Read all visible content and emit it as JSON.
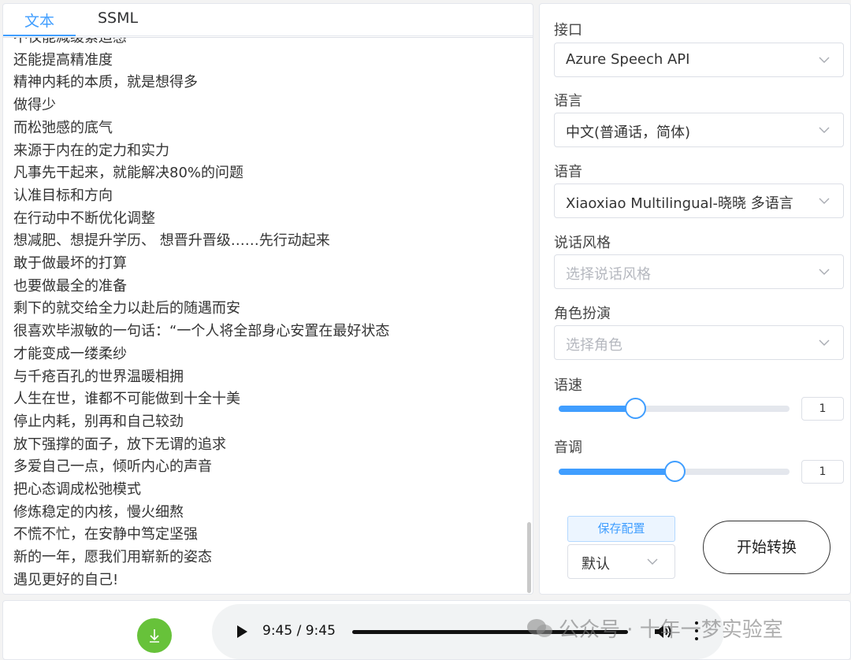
{
  "tabs": {
    "text": "文本",
    "ssml": "SSML"
  },
  "text_lines": [
    "不仅能减缓紧迫感",
    "还能提高精准度",
    "精神内耗的本质，就是想得多",
    "做得少",
    "而松弛感的底气",
    "来源于内在的定力和实力",
    "凡事先干起来，就能解决80%的问题",
    "认准目标和方向",
    "在行动中不断优化调整",
    "想减肥、想提升学历、 想晋升晋级……先行动起来",
    "敢于做最坏的打算",
    "也要做最全的准备",
    "剩下的就交给全力以赴后的随遇而安",
    "很喜欢毕淑敏的一句话：“一个人将全部身心安置在最好状态",
    "才能变成一缕柔纱",
    "与千疮百孔的世界温暖相拥",
    "人生在世，谁都不可能做到十全十美",
    "停止内耗，别再和自己较劲",
    "放下强撑的面子，放下无谓的追求",
    "多爱自己一点，倾听内心的声音",
    "把心态调成松弛模式",
    "修炼稳定的内核，慢火细熬",
    "不慌不忙，在安静中笃定坚强",
    "新的一年，愿我们用崭新的姿态",
    "遇见更好的自己!"
  ],
  "form": {
    "interface_label": "接口",
    "interface_value": "Azure Speech API",
    "language_label": "语言",
    "language_value": "中文(普通话，简体)",
    "voice_label": "语音",
    "voice_value": "Xiaoxiao Multilingual-晓晓 多语言",
    "style_label": "说话风格",
    "style_placeholder": "选择说话风格",
    "role_label": "角色扮演",
    "role_placeholder": "选择角色",
    "rate_label": "语速",
    "rate_value": "1",
    "rate_fraction": 0.33,
    "pitch_label": "音调",
    "pitch_value": "1",
    "pitch_fraction": 0.5
  },
  "actions": {
    "save_label": "保存配置",
    "preset_value": "默认",
    "convert_label": "开始转换"
  },
  "player": {
    "time": "9:45 / 9:45",
    "progress_fraction": 1.0
  },
  "watermark": "公众号 · 十年一梦实验室",
  "colors": {
    "accent": "#409eff",
    "download": "#67c23a"
  }
}
